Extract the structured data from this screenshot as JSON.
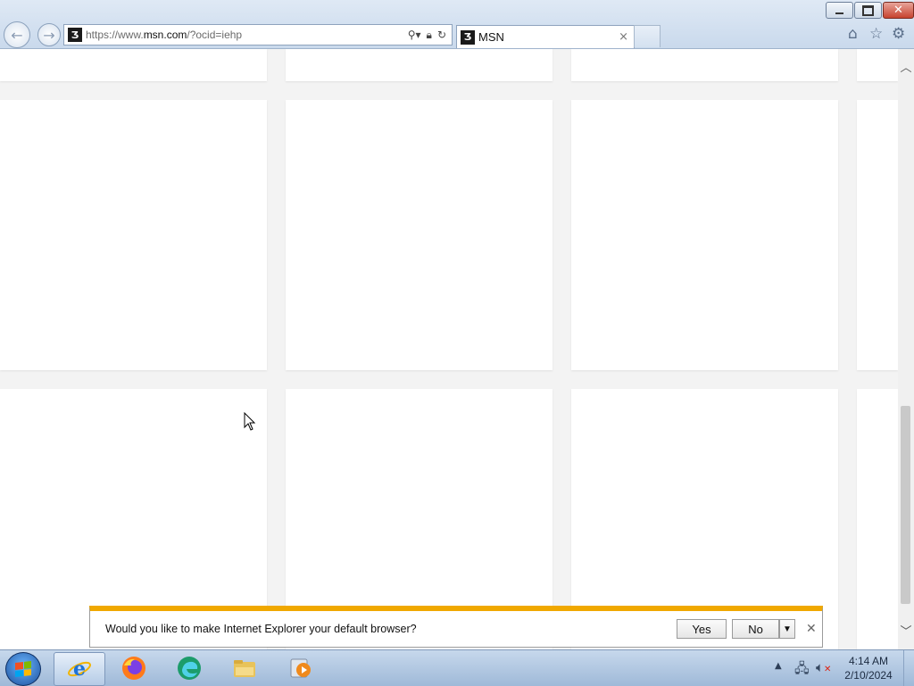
{
  "window": {
    "minimize_glyph": "▭",
    "restore_glyph": "❐",
    "close_glyph": "✕"
  },
  "address_bar": {
    "url_prefix": "https://www.",
    "url_domain": "msn.com",
    "url_rest": "/?ocid=iehp"
  },
  "tab": {
    "title": "MSN",
    "close_glyph": "×"
  },
  "notification": {
    "message": "Would you like to make Internet Explorer your default browser?",
    "yes_label": "Yes",
    "no_label": "No",
    "accent_color": "#f0a800"
  },
  "taskbar": {
    "apps": [
      "internet-explorer",
      "firefox",
      "edge",
      "file-explorer",
      "media-player"
    ]
  },
  "clock": {
    "time": "4:14 AM",
    "date": "2/10/2024"
  }
}
